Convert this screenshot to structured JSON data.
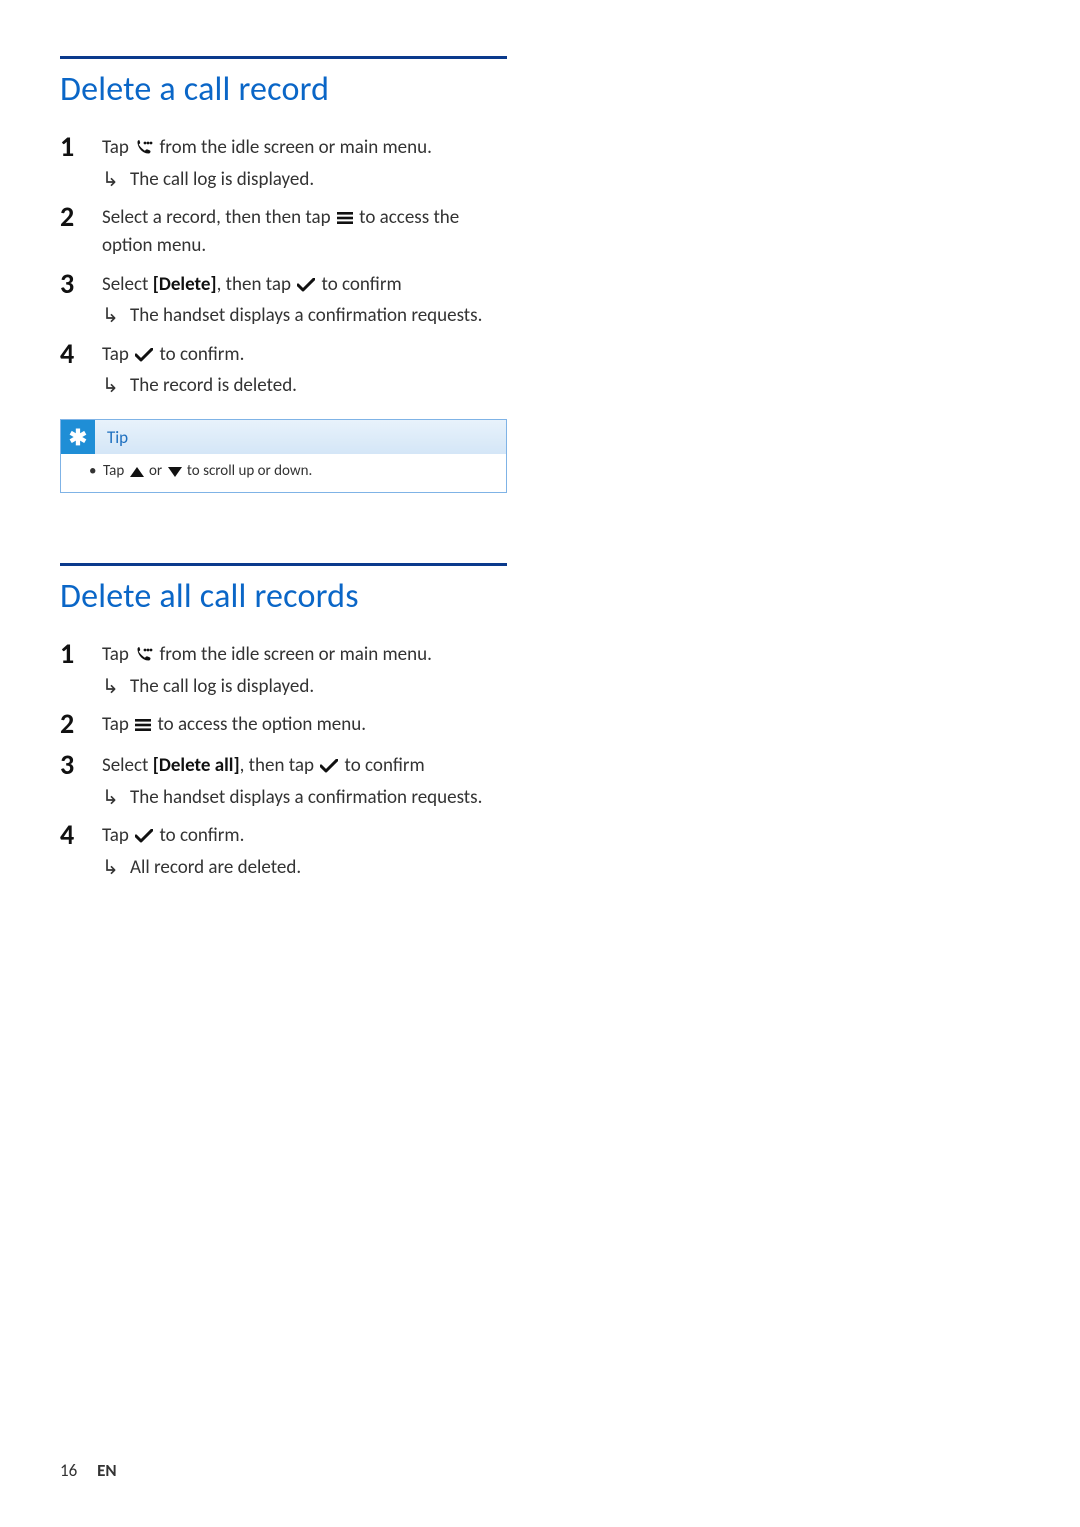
{
  "footer": {
    "page": "16",
    "lang": "EN"
  },
  "tip": {
    "label": "Tip",
    "body_pre": "Tap ",
    "body_mid": " or ",
    "body_post": " to scroll up or down."
  },
  "sections": [
    {
      "heading": "Delete a call record",
      "steps": [
        {
          "num": "1",
          "text_pre": "Tap ",
          "icon": "call-log",
          "text_post": " from the idle screen or main menu.",
          "result": "The call log is displayed."
        },
        {
          "num": "2",
          "text_pre": "Select a record, then then tap ",
          "icon": "menu",
          "text_post": " to access the option menu."
        },
        {
          "num": "3",
          "text_pre": "Select ",
          "bold": "[Delete]",
          "text_mid": ", then tap ",
          "icon": "check",
          "text_post": " to confirm",
          "result": "The handset displays a confirmation requests."
        },
        {
          "num": "4",
          "text_pre": "Tap ",
          "icon": "check",
          "text_post": " to confirm.",
          "result": "The record is deleted."
        }
      ],
      "has_tip": true
    },
    {
      "heading": "Delete all call records",
      "steps": [
        {
          "num": "1",
          "text_pre": "Tap ",
          "icon": "call-log",
          "text_post": " from the idle screen or main menu.",
          "result": "The call log is displayed."
        },
        {
          "num": "2",
          "text_pre": "Tap ",
          "icon": "menu",
          "text_post": " to access the option menu."
        },
        {
          "num": "3",
          "text_pre": "Select ",
          "bold": "[Delete all]",
          "text_mid": ", then tap ",
          "icon": "check",
          "text_post": " to confirm",
          "result": "The handset displays a confirmation requests."
        },
        {
          "num": "4",
          "text_pre": "Tap ",
          "icon": "check",
          "text_post": " to confirm.",
          "result": "All record are deleted."
        }
      ],
      "has_tip": false
    }
  ]
}
